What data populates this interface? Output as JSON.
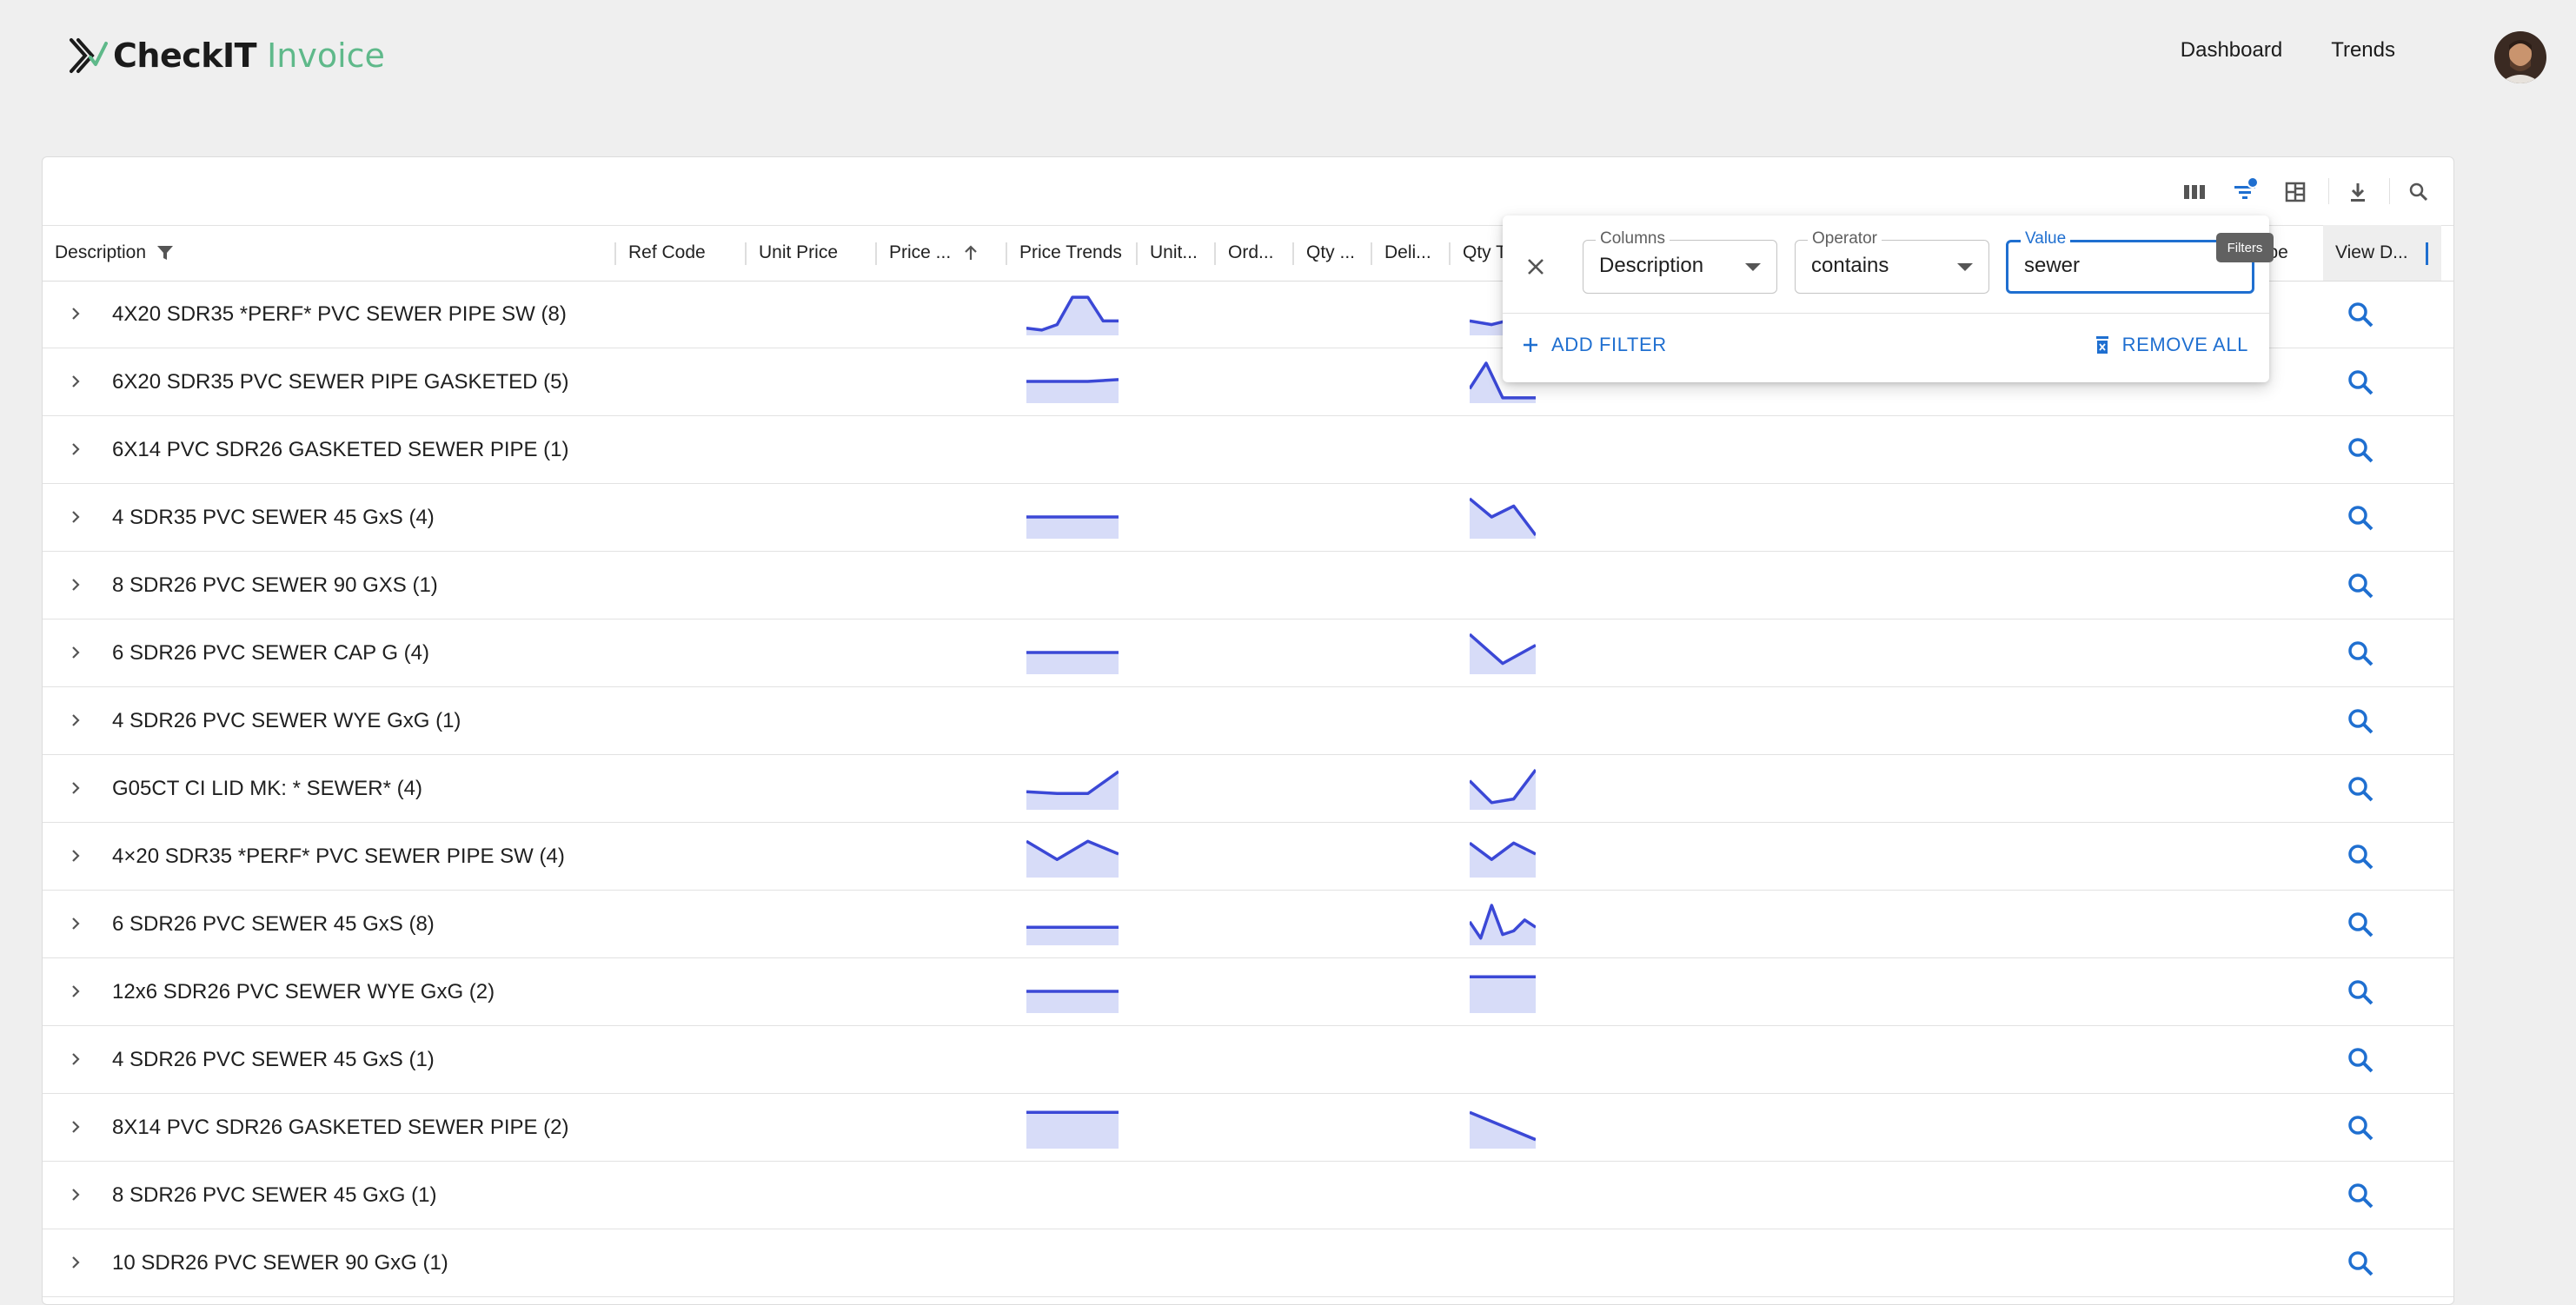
{
  "app": {
    "brand_main": "CheckIT",
    "brand_sub": "Invoice",
    "nav": [
      "Dashboard",
      "Trends"
    ]
  },
  "grid": {
    "columns": [
      "Description",
      "Ref Code",
      "Unit Price",
      "Price ...",
      "Price Trends",
      "Unit...",
      "Ord...",
      "Qty ...",
      "Deli...",
      "Qty T",
      "ype",
      "View D..."
    ],
    "rows": [
      {
        "label": "4X20 SDR35 *PERF* PVC SEWER PIPE SW (8)",
        "price_trend": [
          0.1,
          0.05,
          0.2,
          0.95,
          0.95,
          0.3,
          0.3
        ],
        "qty_trend": [
          0.3,
          0.2,
          0.35,
          1.0
        ]
      },
      {
        "label": "6X20 SDR35 PVC SEWER PIPE GASKETED (5)",
        "price_trend": [
          0.5,
          0.5,
          0.5,
          0.55
        ],
        "qty_trend": [
          0.3,
          1.0,
          0.05,
          0.05,
          0.05
        ]
      },
      {
        "label": "6X14 PVC SDR26 GASKETED SEWER PIPE (1)",
        "price_trend": [],
        "qty_trend": []
      },
      {
        "label": "4 SDR35 PVC SEWER 45 GxS (4)",
        "price_trend": [
          0.5,
          0.5
        ],
        "qty_trend": [
          1.0,
          0.5,
          0.8,
          0.0
        ]
      },
      {
        "label": "8 SDR26 PVC SEWER 90 GXS (1)",
        "price_trend": [],
        "qty_trend": []
      },
      {
        "label": "6 SDR26 PVC SEWER CAP G (4)",
        "price_trend": [
          0.5,
          0.5
        ],
        "qty_trend": [
          1.0,
          0.2,
          0.7
        ]
      },
      {
        "label": "4 SDR26 PVC SEWER WYE GxG (1)",
        "price_trend": [],
        "qty_trend": []
      },
      {
        "label": "G05CT CI LID MK: * SEWER* (4)",
        "price_trend": [
          0.4,
          0.35,
          0.35,
          0.95
        ],
        "qty_trend": [
          0.7,
          0.1,
          0.2,
          1.0
        ]
      },
      {
        "label": "4×20 SDR35 *PERF* PVC SEWER PIPE SW (4)",
        "price_trend": [
          0.9,
          0.4,
          0.9,
          0.55
        ],
        "qty_trend": [
          0.85,
          0.4,
          0.85,
          0.55
        ]
      },
      {
        "label": "6 SDR26 PVC SEWER 45 GxS (8)",
        "price_trend": [
          0.4,
          0.4
        ],
        "qty_trend": [
          0.55,
          0.1,
          1.0,
          0.2,
          0.3,
          0.6,
          0.4
        ]
      },
      {
        "label": "12x6 SDR26 PVC SEWER WYE GxG (2)",
        "price_trend": [
          0.5,
          0.5
        ],
        "qty_trend": [
          0.9,
          0.9
        ]
      },
      {
        "label": "4 SDR26 PVC SEWER 45 GxS (1)",
        "price_trend": [],
        "qty_trend": []
      },
      {
        "label": "8X14 PVC SDR26 GASKETED SEWER PIPE (2)",
        "price_trend": [
          0.9,
          0.9
        ],
        "qty_trend": [
          0.9,
          0.15
        ]
      },
      {
        "label": "8 SDR26 PVC SEWER 45 GxG (1)",
        "price_trend": [],
        "qty_trend": []
      },
      {
        "label": "10 SDR26 PVC SEWER 90 GxG (1)",
        "price_trend": [],
        "qty_trend": []
      }
    ]
  },
  "filter_panel": {
    "columns_label": "Columns",
    "columns_value": "Description",
    "operator_label": "Operator",
    "operator_value": "contains",
    "value_label": "Value",
    "value": "sewer",
    "add_filter": "ADD FILTER",
    "remove_all": "REMOVE ALL"
  },
  "tooltip": "Filters",
  "colors": {
    "accent": "#1f6fd0",
    "spark_line": "#3b48d6",
    "spark_fill": "#d7dcf8",
    "brand_green": "#5fb98a"
  },
  "icons": [
    "columns-icon",
    "filter-icon",
    "density-icon",
    "download-icon",
    "search-icon",
    "close-icon",
    "plus-icon",
    "trash-icon",
    "chevron-right-icon",
    "magnifier-icon"
  ]
}
